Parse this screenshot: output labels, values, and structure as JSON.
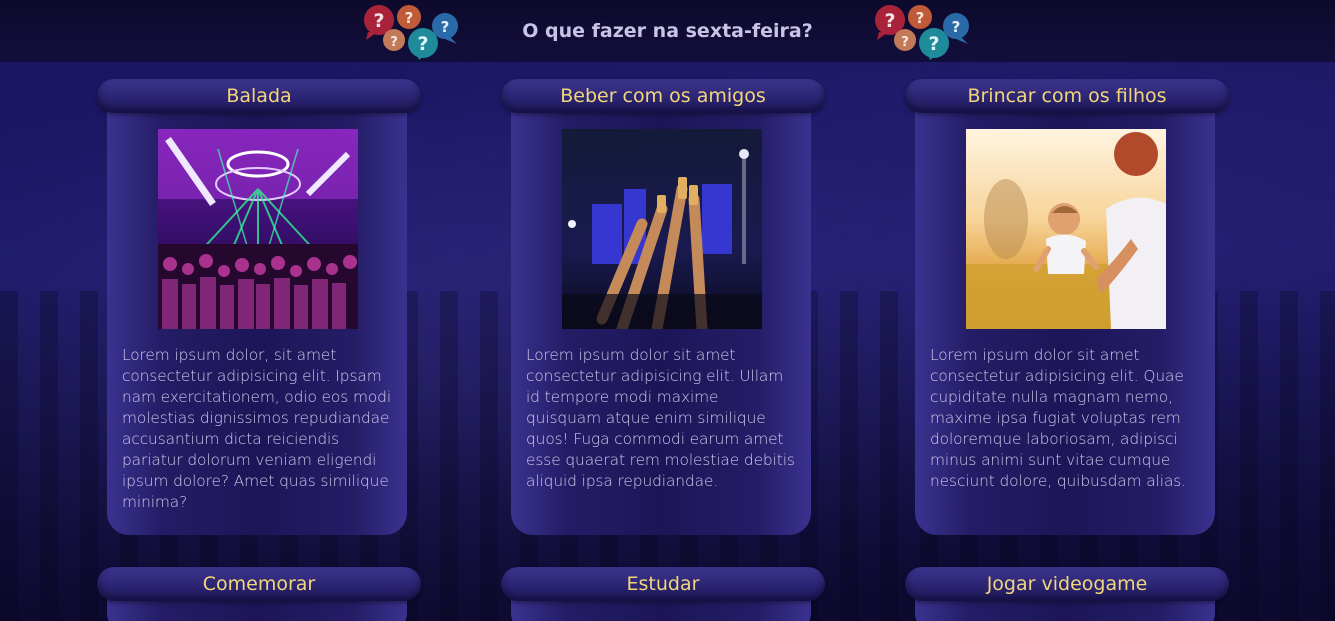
{
  "header": {
    "title": "O que fazer na sexta-feira?",
    "icon_name": "question-bubbles-icon"
  },
  "cards": [
    {
      "title": "Balada",
      "image": "nightclub-party-photo",
      "text": "Lorem ipsum dolor, sit amet consectetur adipisicing elit. Ipsam nam exercitationem, odio eos modi molestias dignissimos repudiandae accusantium dicta reiciendis pariatur dolorum veniam eligendi ipsum dolore? Amet quas similique minima?"
    },
    {
      "title": "Beber com os amigos",
      "image": "friends-toasting-photo",
      "text": "Lorem ipsum dolor sit amet consectetur adipisicing elit. Ullam id tempore modi maxime quisquam atque enim similique quos! Fuga commodi earum amet esse quaerat rem molestiae debitis aliquid ipsa repudiandae."
    },
    {
      "title": "Brincar com os filhos",
      "image": "father-and-child-photo",
      "text": "Lorem ipsum dolor sit amet consectetur adipisicing elit. Quae cupiditate nulla magnam nemo, maxime ipsa fugiat voluptas rem doloremque laboriosam, adipisci minus animi sunt vitae cumque nesciunt dolore, quibusdam alias."
    },
    {
      "title": "Comemorar"
    },
    {
      "title": "Estudar"
    },
    {
      "title": "Jogar videogame"
    }
  ],
  "colors": {
    "background": "#1a1660",
    "card_title": "#f2d77a",
    "card_text": "#cfc8ea"
  }
}
